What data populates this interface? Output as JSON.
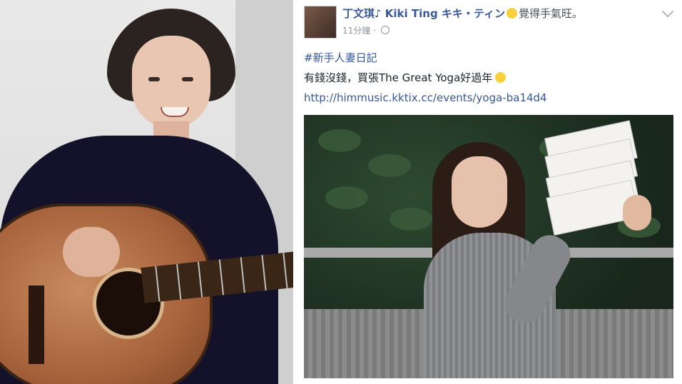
{
  "post": {
    "author": "丁文琪♪ Kiki Ting キキ・ティン",
    "feeling": "覺得手氣旺。",
    "timestamp": "11分鐘",
    "hashtag": "#新手人妻日記",
    "text": "有錢沒錢，買張The Great Yoga好過年",
    "link": "http://himmusic.kktix.cc/events/yoga-ba14d4"
  },
  "colors": {
    "link": "#365899",
    "author": "#3b5998",
    "meta": "#90949c"
  }
}
